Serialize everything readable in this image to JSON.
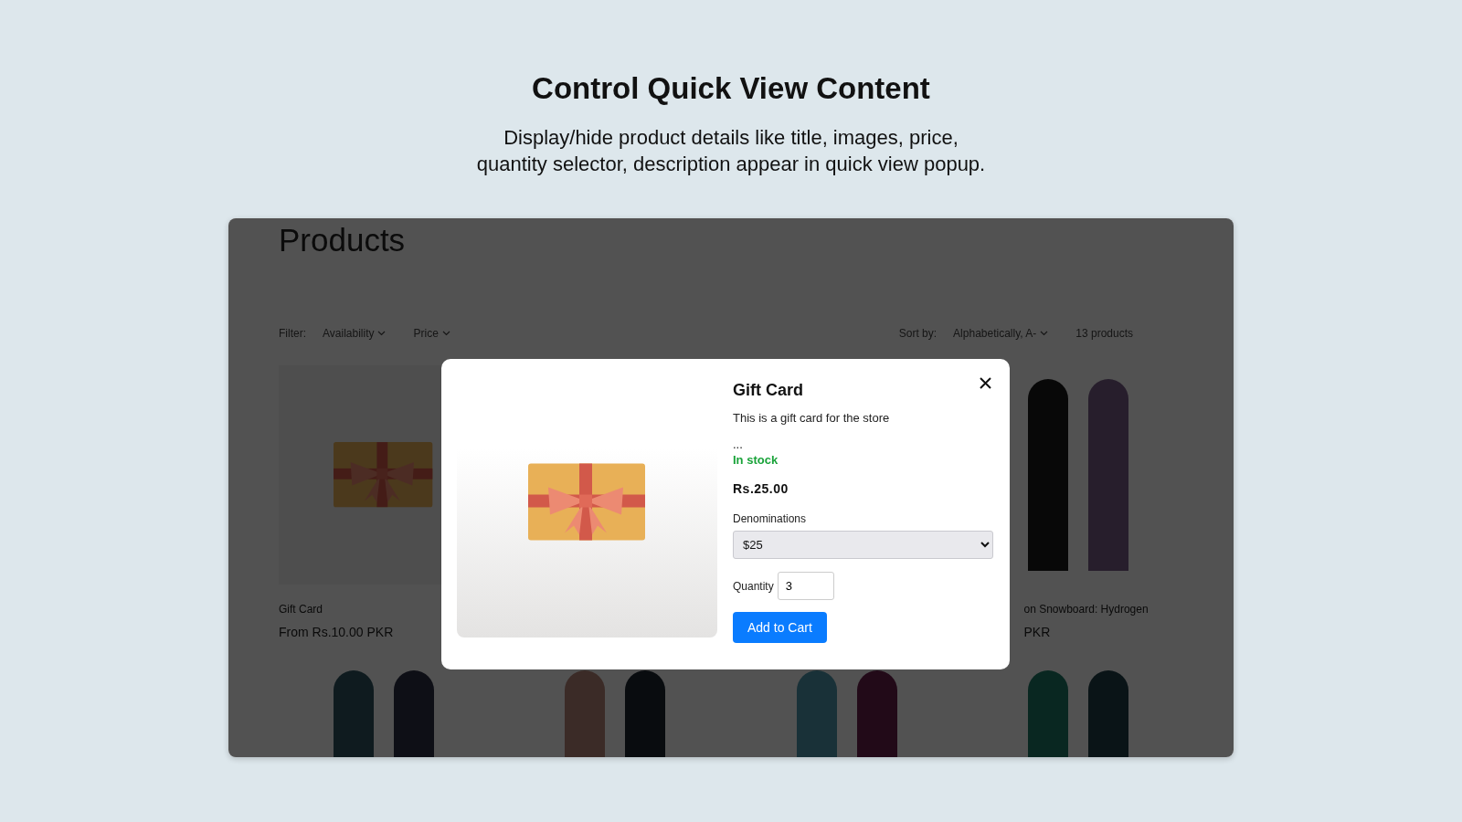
{
  "header": {
    "title": "Control Quick View Content",
    "subtitle": "Display/hide product details like title, images, price,\nquantity selector, description appear in quick view popup."
  },
  "store": {
    "heading": "Products",
    "filter_label": "Filter:",
    "filters": [
      {
        "label": "Availability"
      },
      {
        "label": "Price"
      }
    ],
    "sort_label": "Sort by:",
    "sort_value": "Alphabetically, A-",
    "product_count": "13 products",
    "products": [
      {
        "kind": "gift-card",
        "name": "Gift Card",
        "price": "From Rs.10.00 PKR"
      },
      {
        "kind": "snowboards",
        "name": "on Snowboard: Hydrogen",
        "price": "PKR"
      }
    ]
  },
  "quick_view": {
    "title": "Gift Card",
    "description": "This is a gift card for the store",
    "ellipsis": "...",
    "stock": "In stock",
    "in_stock": true,
    "price": "Rs.25.00",
    "variant_label": "Denominations",
    "variant_value": "$25",
    "quantity_label": "Quantity",
    "quantity_value": "3",
    "button": "Add to Cart"
  }
}
